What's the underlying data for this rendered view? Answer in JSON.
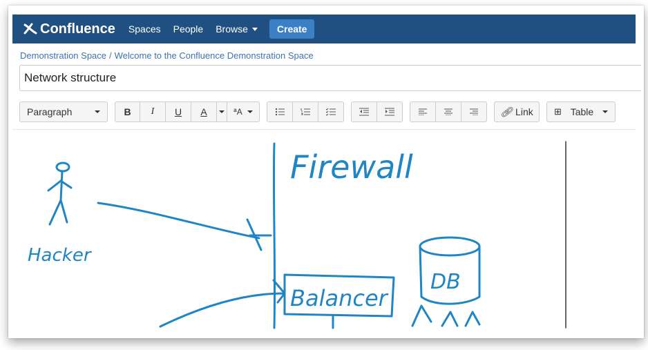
{
  "header": {
    "logo_text": "Confluence",
    "nav": [
      {
        "label": "Spaces"
      },
      {
        "label": "People"
      },
      {
        "label": "Browse"
      }
    ],
    "create_label": "Create"
  },
  "breadcrumb": {
    "space": "Demonstration Space",
    "separator": "/",
    "page": "Welcome to the Confluence Demonstration Space"
  },
  "editor": {
    "title_value": "Network structure"
  },
  "toolbar": {
    "paragraph_label": "Paragraph",
    "bold": "B",
    "italic": "I",
    "underline": "U",
    "text_color": "A",
    "more_formatting": "ªA",
    "link_label": "Link",
    "table_label": "Table"
  },
  "drawing": {
    "labels": {
      "hacker": "Hacker",
      "firewall": "Firewall",
      "balancer": "Balancer",
      "db": "DB"
    },
    "ink_color": "#1f85c4"
  },
  "colors": {
    "header_bg": "#205081",
    "create_btn": "#3b7fc4",
    "link": "#3b73af"
  }
}
